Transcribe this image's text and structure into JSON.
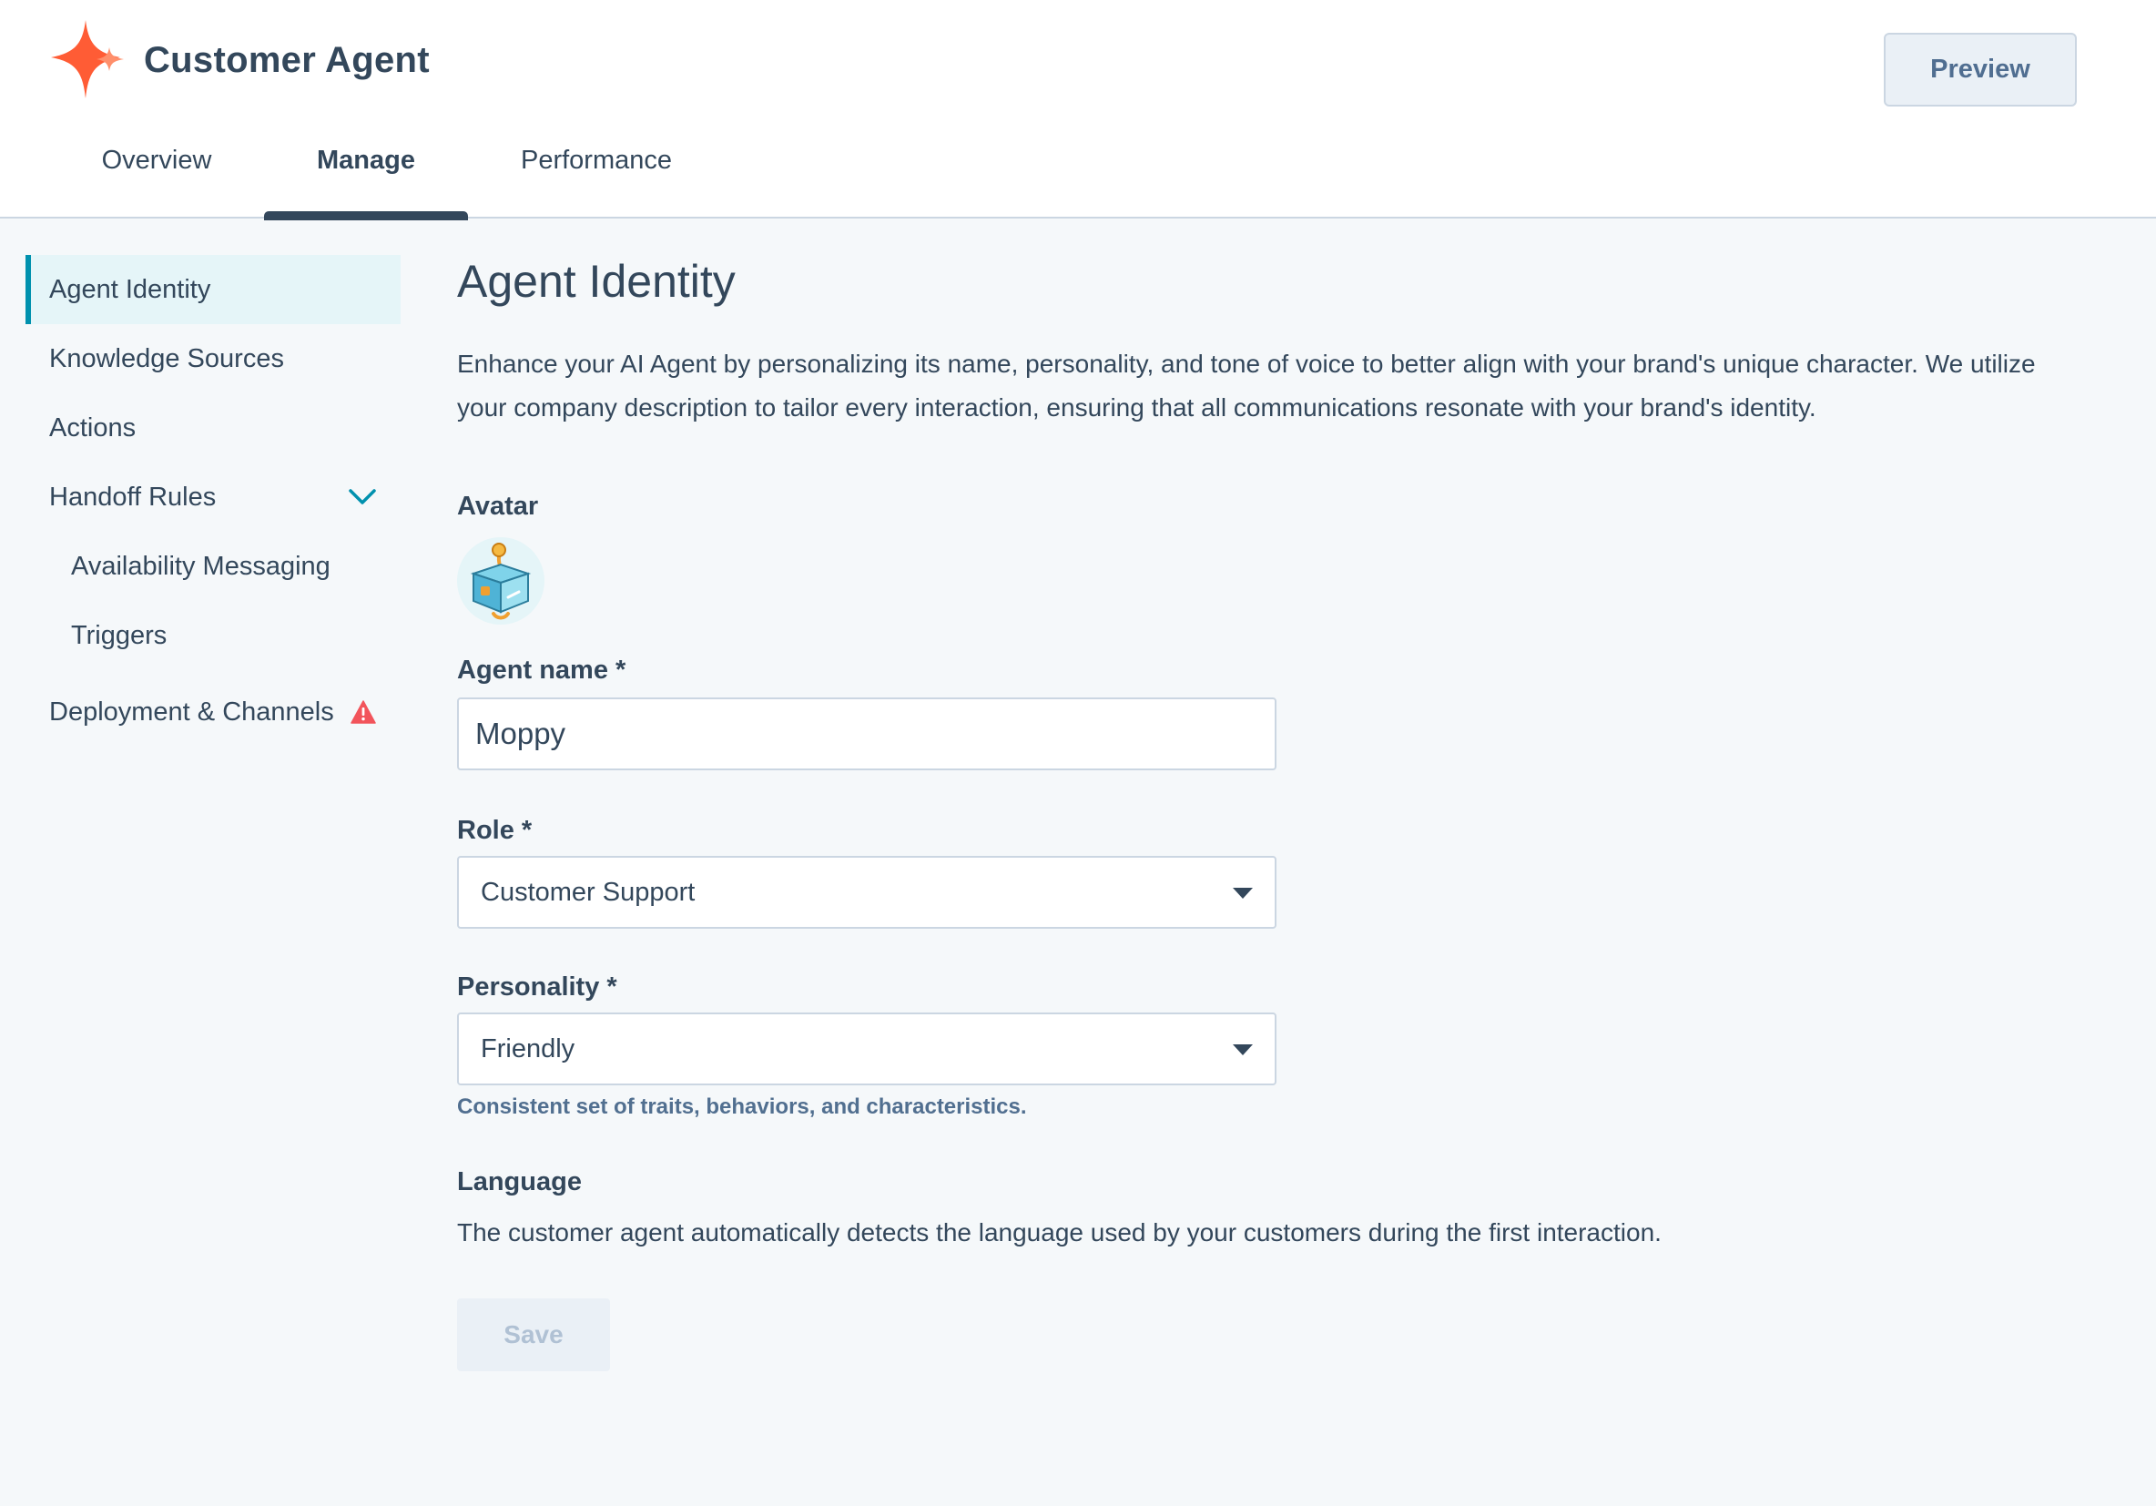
{
  "header": {
    "app_title": "Customer Agent",
    "logo_icon": "sparkle-icon",
    "preview_label": "Preview"
  },
  "tabs": [
    {
      "label": "Overview",
      "active": false
    },
    {
      "label": "Manage",
      "active": true
    },
    {
      "label": "Performance",
      "active": false
    }
  ],
  "sidebar": {
    "items": [
      {
        "label": "Agent Identity",
        "active": true
      },
      {
        "label": "Knowledge Sources"
      },
      {
        "label": "Actions"
      },
      {
        "label": "Handoff Rules",
        "expanded": true,
        "icon": "chevron-down-icon"
      },
      {
        "label": "Availability Messaging",
        "sub": true
      },
      {
        "label": "Triggers",
        "sub": true
      },
      {
        "label": "Deployment & Channels",
        "icon": "warning-icon"
      }
    ]
  },
  "main": {
    "title": "Agent Identity",
    "description": "Enhance your AI Agent by personalizing its name, personality, and tone of voice to better align with your brand's unique character. We utilize your company description to tailor every interaction, ensuring that all communications resonate with your brand's identity.",
    "avatar_label": "Avatar",
    "agent_name_label": "Agent name *",
    "agent_name_value": "Moppy",
    "role_label": "Role *",
    "role_value": "Customer Support",
    "personality_label": "Personality *",
    "personality_value": "Friendly",
    "personality_help": "Consistent set of traits, behaviors, and characteristics.",
    "language_label": "Language",
    "language_desc": "The customer agent automatically detects the language used by your customers during the first interaction.",
    "save_label": "Save"
  },
  "colors": {
    "accent": "#0091ae",
    "brand": "#ff5c35",
    "text": "#33475b",
    "warning": "#f2545b"
  }
}
